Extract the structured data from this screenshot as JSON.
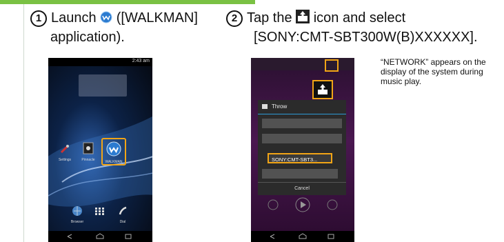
{
  "step1": {
    "number": "1",
    "text_before_icon": "Launch ",
    "text_after_icon": " ([WALKMAN]",
    "line2": "application)."
  },
  "step2": {
    "number": "2",
    "text_before_icon": "Tap the ",
    "text_after_icon": " icon and select",
    "line2": "[SONY:CMT-SBT300W(B)XXXXXX]."
  },
  "note": "“NETWORK” appears on the display of the system during music play.",
  "phone1": {
    "status_time": "2:43 am",
    "apps": [
      "Settings",
      "Pinnacle",
      "WALKMAN"
    ],
    "dock": [
      "Browser",
      "Dial"
    ]
  },
  "phone2": {
    "menu_title": "Throw",
    "devices": [
      "SONY:CMT-SBT3..."
    ],
    "cancel": "Cancel"
  },
  "colors": {
    "accent": "#7ac143",
    "highlight": "#f2a516"
  }
}
